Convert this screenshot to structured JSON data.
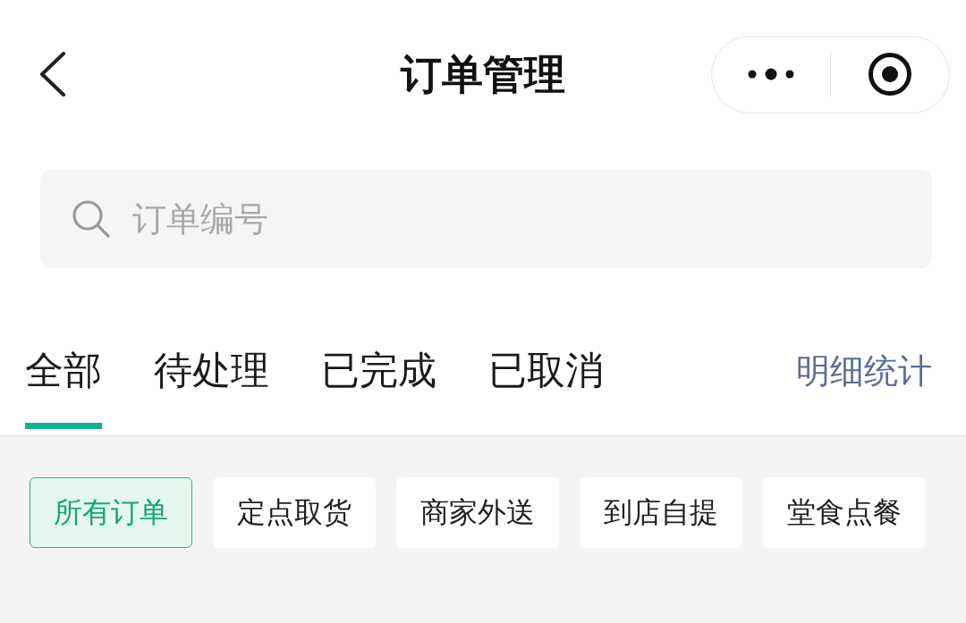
{
  "nav": {
    "title": "订单管理"
  },
  "search": {
    "placeholder": "订单编号"
  },
  "tabs": [
    {
      "label": "全部",
      "selected": true
    },
    {
      "label": "待处理",
      "selected": false
    },
    {
      "label": "已完成",
      "selected": false
    },
    {
      "label": "已取消",
      "selected": false
    }
  ],
  "detail_link": "明细统计",
  "filters": [
    {
      "label": "所有订单",
      "selected": true
    },
    {
      "label": "定点取货",
      "selected": false
    },
    {
      "label": "商家外送",
      "selected": false
    },
    {
      "label": "到店自提",
      "selected": false
    },
    {
      "label": "堂食点餐",
      "selected": false
    }
  ]
}
